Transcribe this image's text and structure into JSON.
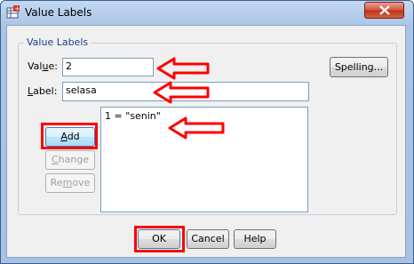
{
  "window": {
    "title": "Value Labels"
  },
  "group": {
    "legend": "Value Labels"
  },
  "value_field": {
    "label_prefix": "Val",
    "label_accel": "u",
    "label_suffix": "e:",
    "value": "2"
  },
  "label_field": {
    "label_accel": "L",
    "label_suffix": "abel:",
    "value": "selasa"
  },
  "buttons": {
    "spelling": "Spelling...",
    "add_accel": "A",
    "add_rest": "dd",
    "change_accel": "C",
    "change_rest": "hange",
    "remove_prefix": "Re",
    "remove_accel": "m",
    "remove_rest": "ove",
    "ok": "OK",
    "cancel": "Cancel",
    "help": "Help"
  },
  "list": {
    "items": [
      "1 = \"senin\""
    ]
  },
  "colors": {
    "highlight": "#ff0000",
    "legend_text": "#1e3e8a",
    "close_button": "#c0301a"
  },
  "icons": {
    "title": "variable-table-icon",
    "close": "close-icon",
    "annotation": "arrow-left-icon"
  }
}
